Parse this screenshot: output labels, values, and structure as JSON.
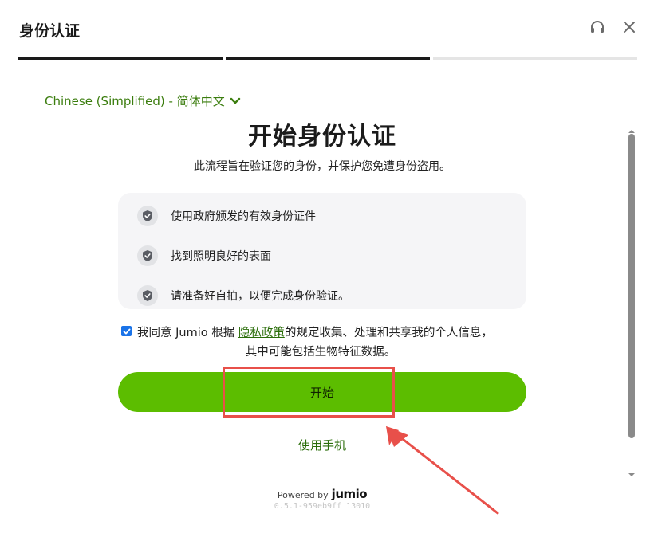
{
  "header": {
    "title": "身份认证",
    "support_icon": "headset-icon",
    "close_icon": "close-icon"
  },
  "progress": {
    "current_step": 2,
    "total_steps": 3
  },
  "language": {
    "label": "Chinese (Simplified) - 简体中文"
  },
  "main": {
    "title": "开始身份认证",
    "subtitle": "此流程旨在验证您的身份，并保护您免遭身份盗用。"
  },
  "requirements": [
    {
      "text": "使用政府颁发的有效身份证件",
      "icon": "shield-check-icon"
    },
    {
      "text": "找到照明良好的表面",
      "icon": "shield-check-icon"
    },
    {
      "text": "请准备好自拍，以便完成身份验证。",
      "icon": "shield-check-icon"
    }
  ],
  "consent": {
    "checked": true,
    "prefix": "我同意 Jumio 根据 ",
    "link": "隐私政策",
    "suffix": "的规定收集、处理和共享我的个人信息，",
    "line2": "其中可能包括生物特征数据。"
  },
  "actions": {
    "start_label": "开始",
    "phone_label": "使用手机"
  },
  "footer": {
    "powered_by": "Powered by",
    "brand": "jumio",
    "version": "0.5.1-959eb9ff 13010"
  },
  "colors": {
    "accent": "#5cbd00",
    "link": "#2a6d09",
    "annotation": "#e8504a"
  }
}
